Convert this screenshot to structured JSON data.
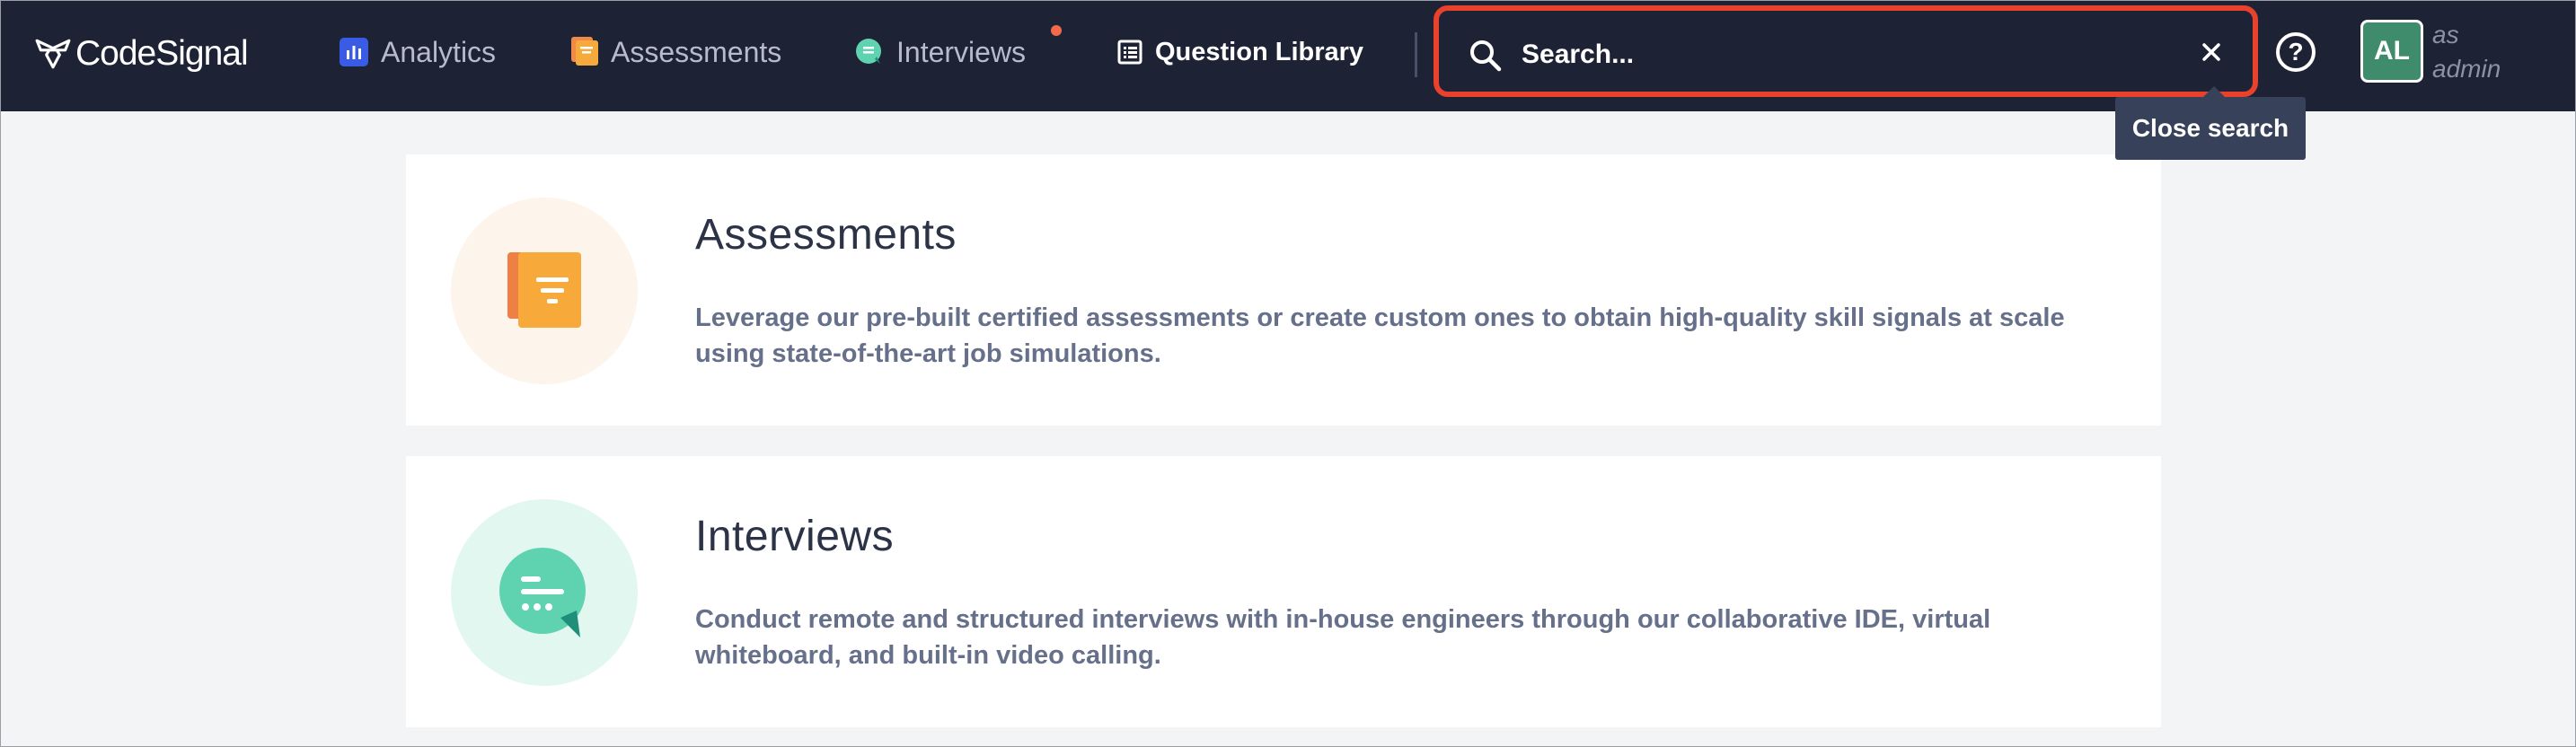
{
  "brand": {
    "logo_text": "CodeSignal",
    "colors": {
      "nav_bg": "#1e2235",
      "accent_red": "#e8412c",
      "avatar_bg": "#3f8c6c"
    }
  },
  "nav": {
    "analytics": {
      "label": "Analytics",
      "icon": "analytics-icon"
    },
    "assessments": {
      "label": "Assessments",
      "icon": "assessments-icon"
    },
    "interviews": {
      "label": "Interviews",
      "icon": "interviews-icon",
      "has_notification": true
    },
    "question_library": {
      "label": "Question Library",
      "icon": "library-icon"
    }
  },
  "search": {
    "placeholder": "Search...",
    "value": "",
    "close_tooltip": "Close search"
  },
  "user": {
    "initials": "AL",
    "role_line1": "as",
    "role_line2": "admin"
  },
  "cards": [
    {
      "title": "Assessments",
      "description": "Leverage our pre-built certified assessments or create custom ones to obtain high-quality skill signals at scale using state-of-the-art job simulations."
    },
    {
      "title": "Interviews",
      "description": "Conduct remote and structured interviews with in-house engineers through our collaborative IDE, virtual whiteboard, and built-in video calling."
    }
  ]
}
